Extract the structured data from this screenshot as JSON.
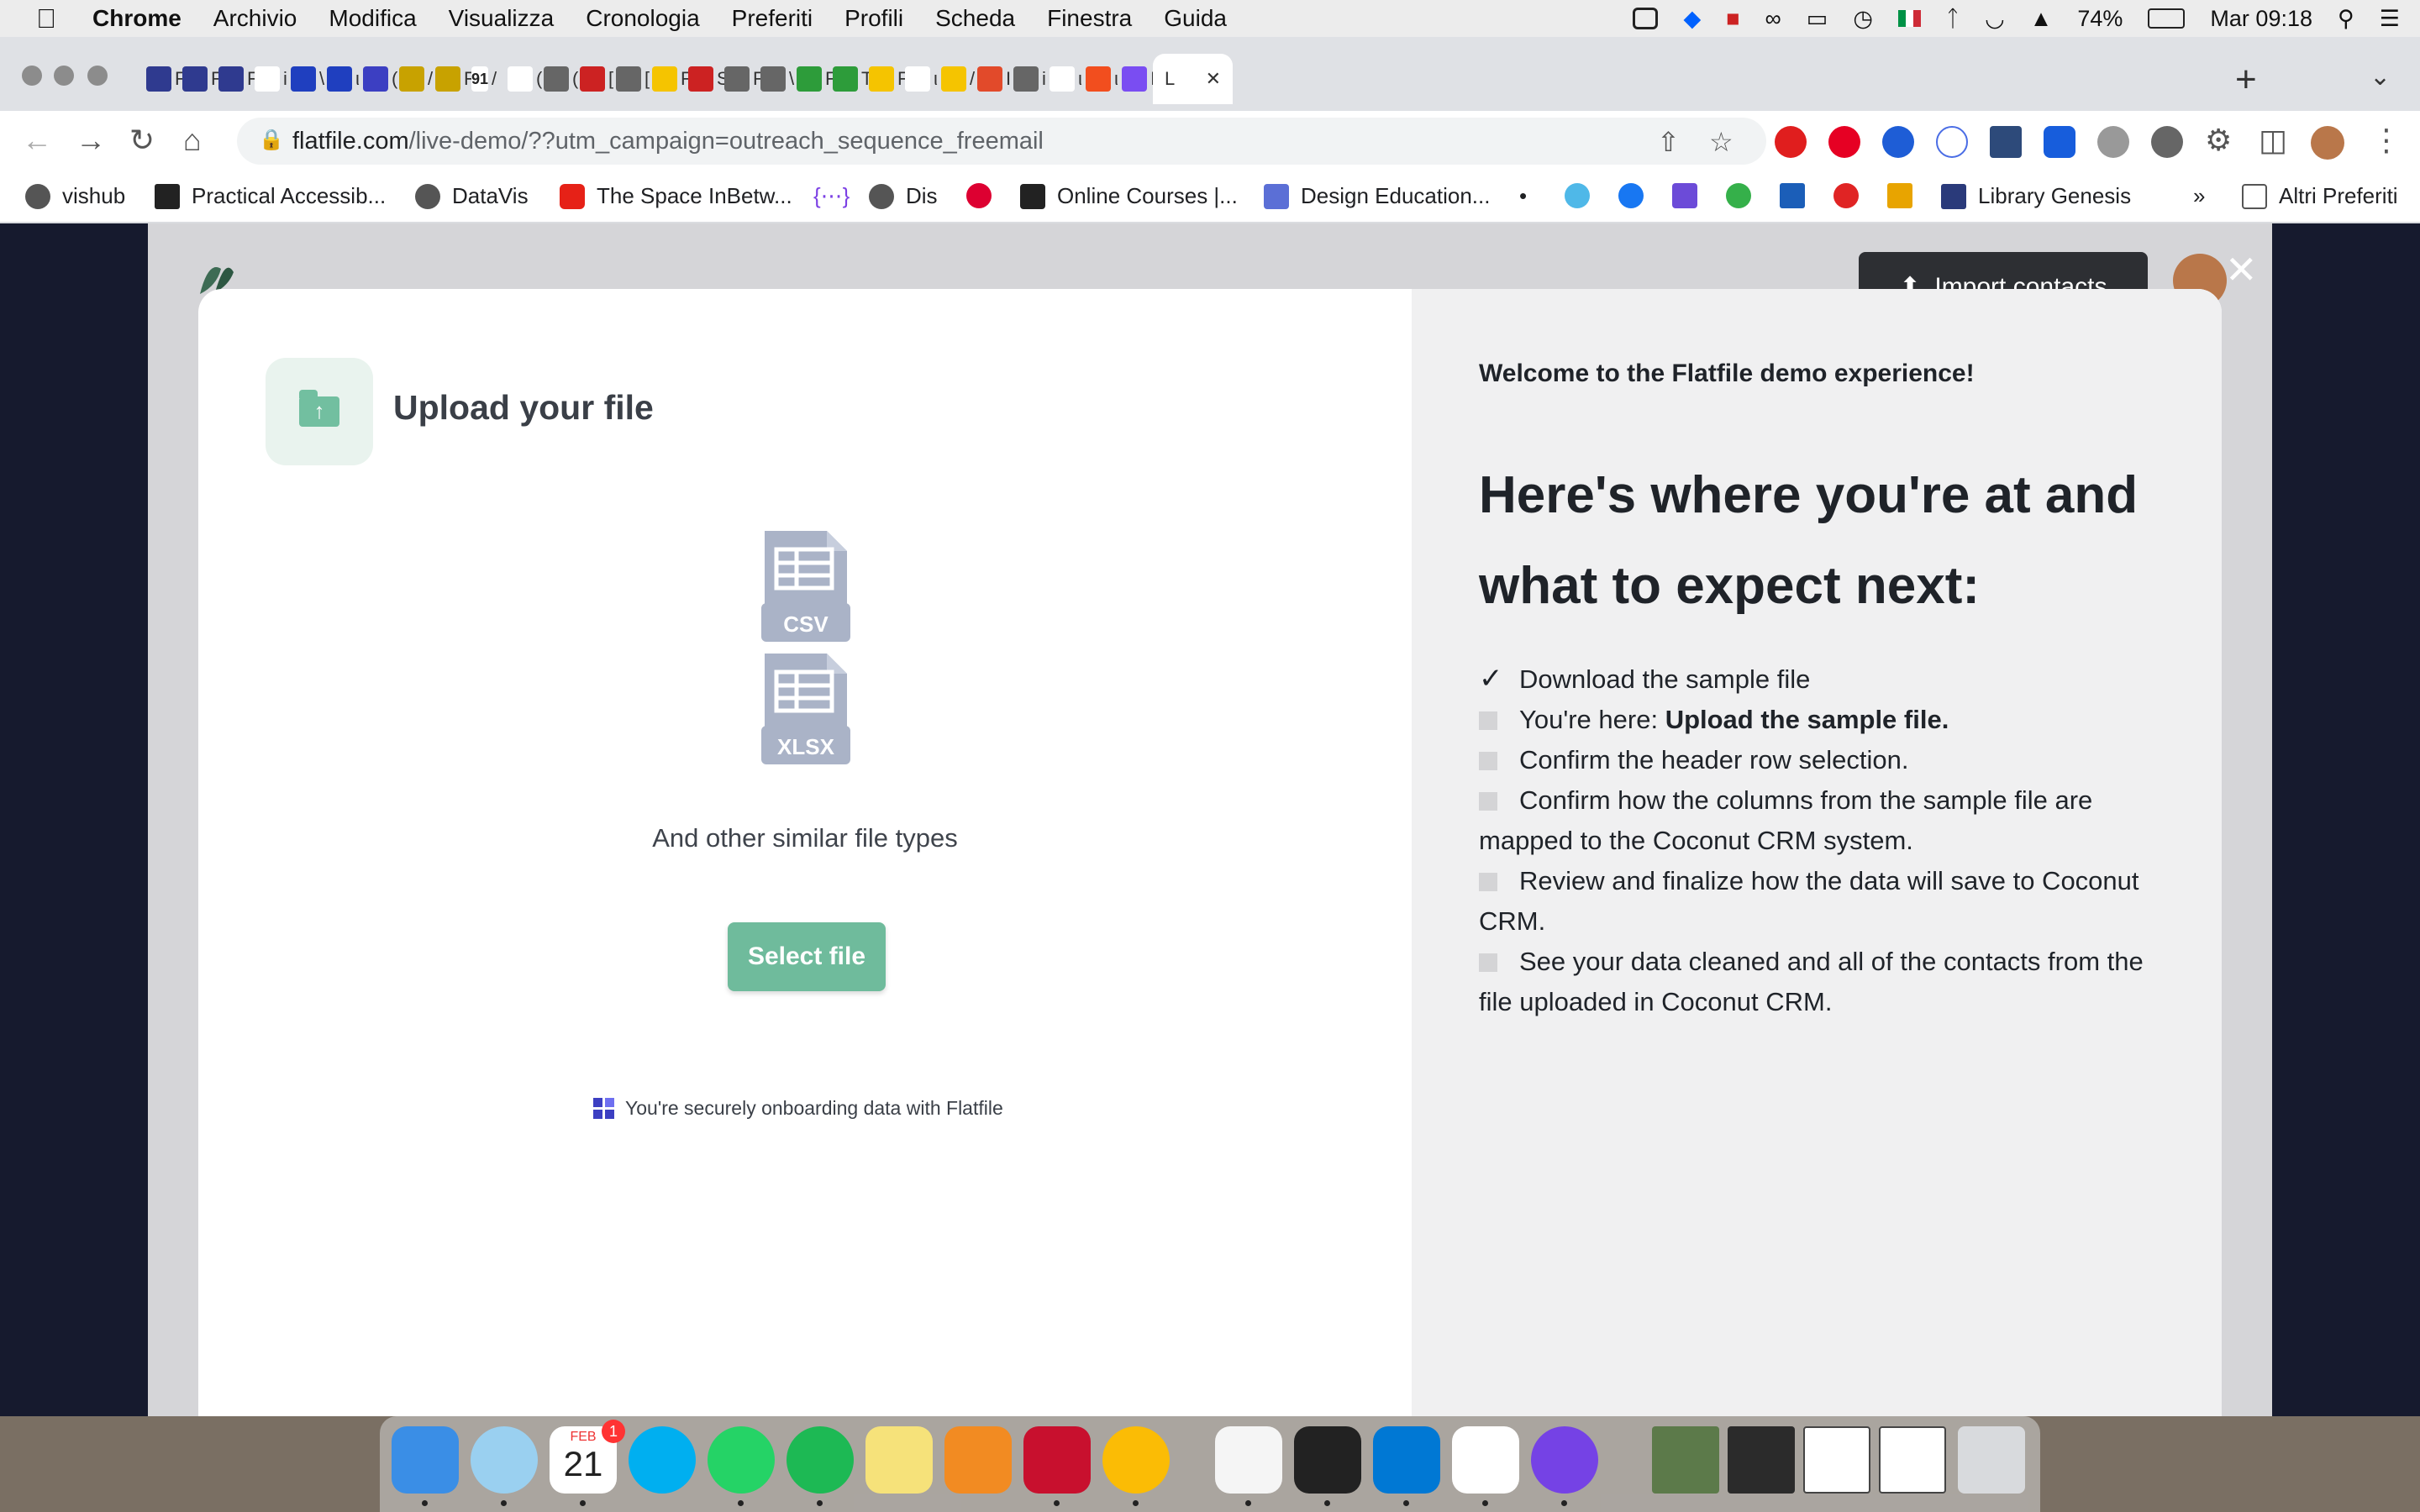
{
  "menubar": {
    "app": "Chrome",
    "items": [
      "Archivio",
      "Modifica",
      "Visualizza",
      "Cronologia",
      "Preferiti",
      "Profili",
      "Scheda",
      "Finestra",
      "Guida"
    ],
    "battery": "74%",
    "clock": "Mar 09:18"
  },
  "tabs": [
    {
      "icon": "notion-icon",
      "letter": "F",
      "color": "#2f3a8f"
    },
    {
      "icon": "notion-icon",
      "letter": "F",
      "color": "#2f3a8f"
    },
    {
      "icon": "notion-icon",
      "letter": "F",
      "color": "#2f3a8f"
    },
    {
      "icon": "google-icon",
      "letter": "i",
      "color": "#ffffff"
    },
    {
      "icon": "eu-flag-icon",
      "letter": "\\",
      "color": "#1f3fbf"
    },
    {
      "icon": "eu-flag-icon",
      "letter": "ι",
      "color": "#1f3fbf"
    },
    {
      "icon": "square-icon",
      "letter": "(",
      "color": "#3c3fc2"
    },
    {
      "icon": "bars-icon",
      "letter": "/",
      "color": "#c8a200"
    },
    {
      "icon": "bars-icon",
      "letter": "F",
      "color": "#c8a200"
    },
    {
      "icon": "text-icon",
      "letter": "/",
      "label": "91",
      "color": "#ffffff"
    },
    {
      "icon": "b-icon",
      "letter": "(",
      "color": "#ffffff"
    },
    {
      "icon": "globe-icon",
      "letter": "(",
      "color": "#666666"
    },
    {
      "icon": "bank-icon",
      "letter": "[",
      "color": "#cc2222"
    },
    {
      "icon": "globe-icon",
      "letter": "[",
      "color": "#666666"
    },
    {
      "icon": "r-icon",
      "letter": "F",
      "color": "#f5c400"
    },
    {
      "icon": "red-icon",
      "letter": "S",
      "color": "#cc2222"
    },
    {
      "icon": "globe-icon",
      "letter": "F",
      "color": "#666666"
    },
    {
      "icon": "globe-icon",
      "letter": "\\",
      "color": "#666666"
    },
    {
      "icon": "r-green-icon",
      "letter": "F",
      "color": "#2d9c3a"
    },
    {
      "icon": "r-green-icon",
      "letter": "T",
      "color": "#2d9c3a"
    },
    {
      "icon": "r-icon",
      "letter": "F",
      "color": "#f5c400"
    },
    {
      "icon": "google-icon",
      "letter": "ι",
      "color": "#ffffff"
    },
    {
      "icon": "yellow-icon",
      "letter": "/",
      "color": "#f5c400"
    },
    {
      "icon": "microsoft-icon",
      "letter": "I",
      "color": "#e24a2a"
    },
    {
      "icon": "globe-icon",
      "letter": "i",
      "color": "#666666"
    },
    {
      "icon": "mountain-icon",
      "letter": "ι",
      "color": "#ffffff"
    },
    {
      "icon": "figma-icon",
      "letter": "ι",
      "color": "#f24e1e"
    },
    {
      "icon": "dots-icon",
      "letter": "I",
      "color": "#7a4df2"
    }
  ],
  "active_tab": {
    "letter": "L"
  },
  "toolbar": {
    "url_host": "flatfile.com",
    "url_path": "/live-demo/??utm_campaign=outreach_sequence_freemail"
  },
  "bookmarks": [
    {
      "label": "vishub",
      "icon": "globe-icon"
    },
    {
      "label": "Practical Accessib...",
      "icon": "clapper-icon"
    },
    {
      "label": "DataVis",
      "icon": "globe-icon"
    },
    {
      "label": "The Space InBetw...",
      "icon": "youtube-icon"
    },
    {
      "label": "",
      "icon": "braces-icon"
    },
    {
      "label": "Dis",
      "icon": "globe-icon"
    },
    {
      "label": "",
      "icon": "angular-icon"
    },
    {
      "label": "Online Courses |...",
      "icon": "courses-icon"
    },
    {
      "label": "Design Education...",
      "icon": "grid-icon"
    },
    {
      "label": "Library Genesis",
      "icon": "library-icon"
    },
    {
      "label": "Altri Preferiti",
      "icon": "folder-icon"
    }
  ],
  "app": {
    "import_button": "Import contacts"
  },
  "modal": {
    "title": "Upload your file",
    "file_types": [
      "CSV",
      "XLSX"
    ],
    "other_types": "And other similar file types",
    "select_button": "Select file",
    "secure_text": "You're securely onboarding data with Flatfile",
    "welcome": "Welcome to the Flatfile demo experience!",
    "heading": "Here's where you're at and what to expect next:",
    "steps": [
      {
        "text": "Download the sample file",
        "done": true
      },
      {
        "prefix": "You're here: ",
        "strong": "Upload the sample file.",
        "done": false
      },
      {
        "text": "Confirm the header row selection.",
        "done": false
      },
      {
        "text": "Confirm how the columns from the sample file are mapped to the Coconut CRM system.",
        "done": false
      },
      {
        "text": "Review and finalize how the data will save to Coconut CRM.",
        "done": false
      },
      {
        "text": "See your data cleaned and all of the contacts from the file uploaded in Coconut CRM.",
        "done": false
      }
    ]
  },
  "dock": {
    "calendar_month": "FEB",
    "calendar_day": "21",
    "calendar_badge": "1",
    "apps": [
      "finder-icon",
      "mail-icon",
      "calendar-icon",
      "skype-icon",
      "whatsapp-icon",
      "spotify-icon",
      "notes-icon",
      "books-icon",
      "acrobat-icon",
      "chrome-icon",
      "pages-icon",
      "terminal-icon",
      "vscode-icon",
      "numbers-icon",
      "firefox-icon"
    ]
  }
}
